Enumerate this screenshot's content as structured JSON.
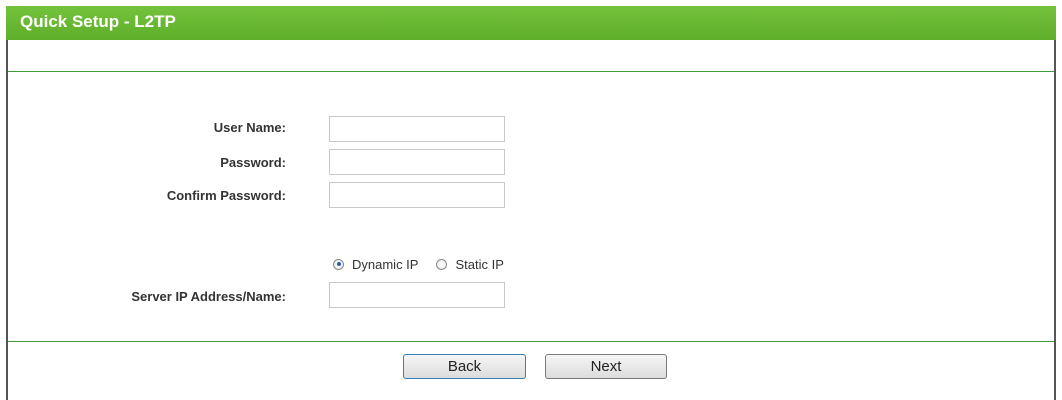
{
  "header": {
    "title": "Quick Setup - L2TP"
  },
  "form": {
    "user_name": {
      "label": "User Name:",
      "value": ""
    },
    "password": {
      "label": "Password:",
      "value": ""
    },
    "confirm_password": {
      "label": "Confirm Password:",
      "value": ""
    },
    "ip_mode": {
      "options": [
        {
          "label": "Dynamic IP",
          "checked": true
        },
        {
          "label": "Static IP",
          "checked": false
        }
      ]
    },
    "server": {
      "label": "Server IP Address/Name:",
      "value": ""
    }
  },
  "buttons": {
    "back_label": "Back",
    "next_label": "Next"
  },
  "colors": {
    "header_green": "#5fae2a",
    "rule_green": "#3f9a3f",
    "focus_blue": "#3c7fb1"
  }
}
